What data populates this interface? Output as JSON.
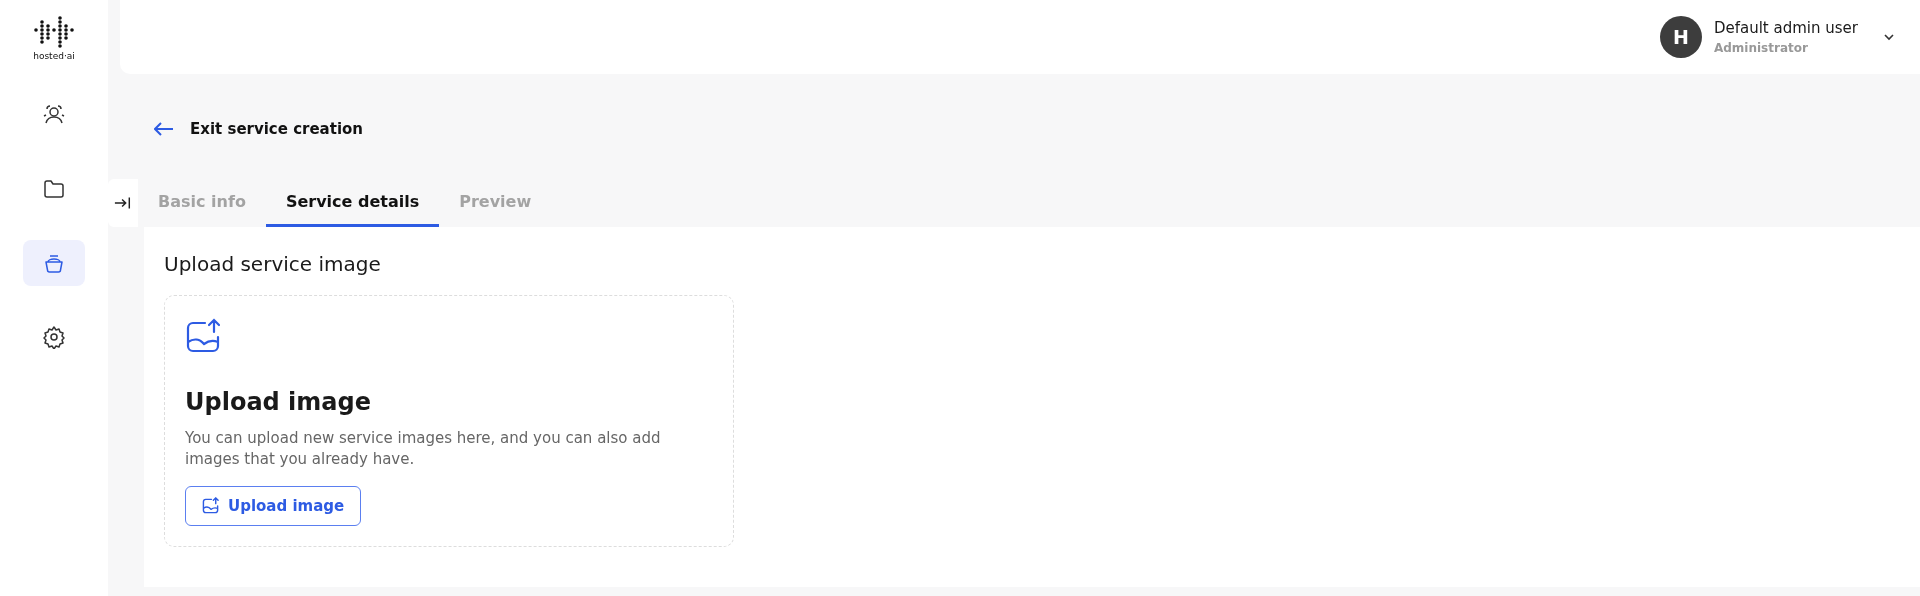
{
  "logo": {
    "text": "hosted·ai"
  },
  "sidebar": {
    "items": [
      {
        "kind": "users",
        "selected": false
      },
      {
        "kind": "folder",
        "selected": false
      },
      {
        "kind": "service",
        "selected": true
      },
      {
        "kind": "settings",
        "selected": false
      }
    ]
  },
  "user": {
    "initial": "H",
    "name": "Default admin user",
    "role": "Administrator"
  },
  "back_link": "Exit service creation",
  "tabs": [
    {
      "label": "Basic info",
      "selected": false
    },
    {
      "label": "Service details",
      "selected": true
    },
    {
      "label": "Preview",
      "selected": false
    }
  ],
  "section": {
    "title": "Upload service image",
    "upload": {
      "title": "Upload image",
      "description": "You can upload new service images here, and you can also add images that you already have.",
      "button": "Upload image"
    }
  }
}
